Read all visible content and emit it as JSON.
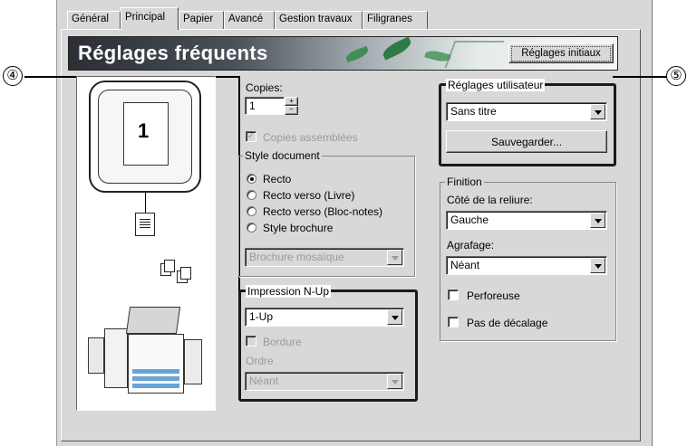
{
  "tabs": [
    "Général",
    "Principal",
    "Papier",
    "Avancé",
    "Gestion travaux",
    "Filigranes"
  ],
  "active_tab": "Principal",
  "banner": {
    "title": "Réglages fréquents",
    "reset_button": "Réglages initiaux"
  },
  "callouts": {
    "left": "④",
    "right": "⑤"
  },
  "preview": {
    "page_number": "1"
  },
  "copies": {
    "label": "Copies:",
    "value": "1",
    "collate_label": "Copies assemblées",
    "collate_checked": true,
    "collate_enabled": false
  },
  "style_document": {
    "title": "Style document",
    "options": [
      "Recto",
      "Recto verso (Livre)",
      "Recto verso (Bloc-notes)",
      "Style brochure"
    ],
    "selected": "Recto",
    "brochure_select": "Brochure mosaïque"
  },
  "nup": {
    "title": "Impression N-Up",
    "value": "1-Up",
    "border_label": "Bordure",
    "order_label": "Ordre",
    "order_value": "Néant"
  },
  "user_settings": {
    "title": "Réglages utilisateur",
    "value": "Sans titre",
    "save_button": "Sauvegarder..."
  },
  "finishing": {
    "title": "Finition",
    "binding_label": "Côté de la reliure:",
    "binding_value": "Gauche",
    "staple_label": "Agrafage:",
    "staple_value": "Néant",
    "punch_label": "Perforeuse",
    "offset_label": "Pas de décalage"
  }
}
